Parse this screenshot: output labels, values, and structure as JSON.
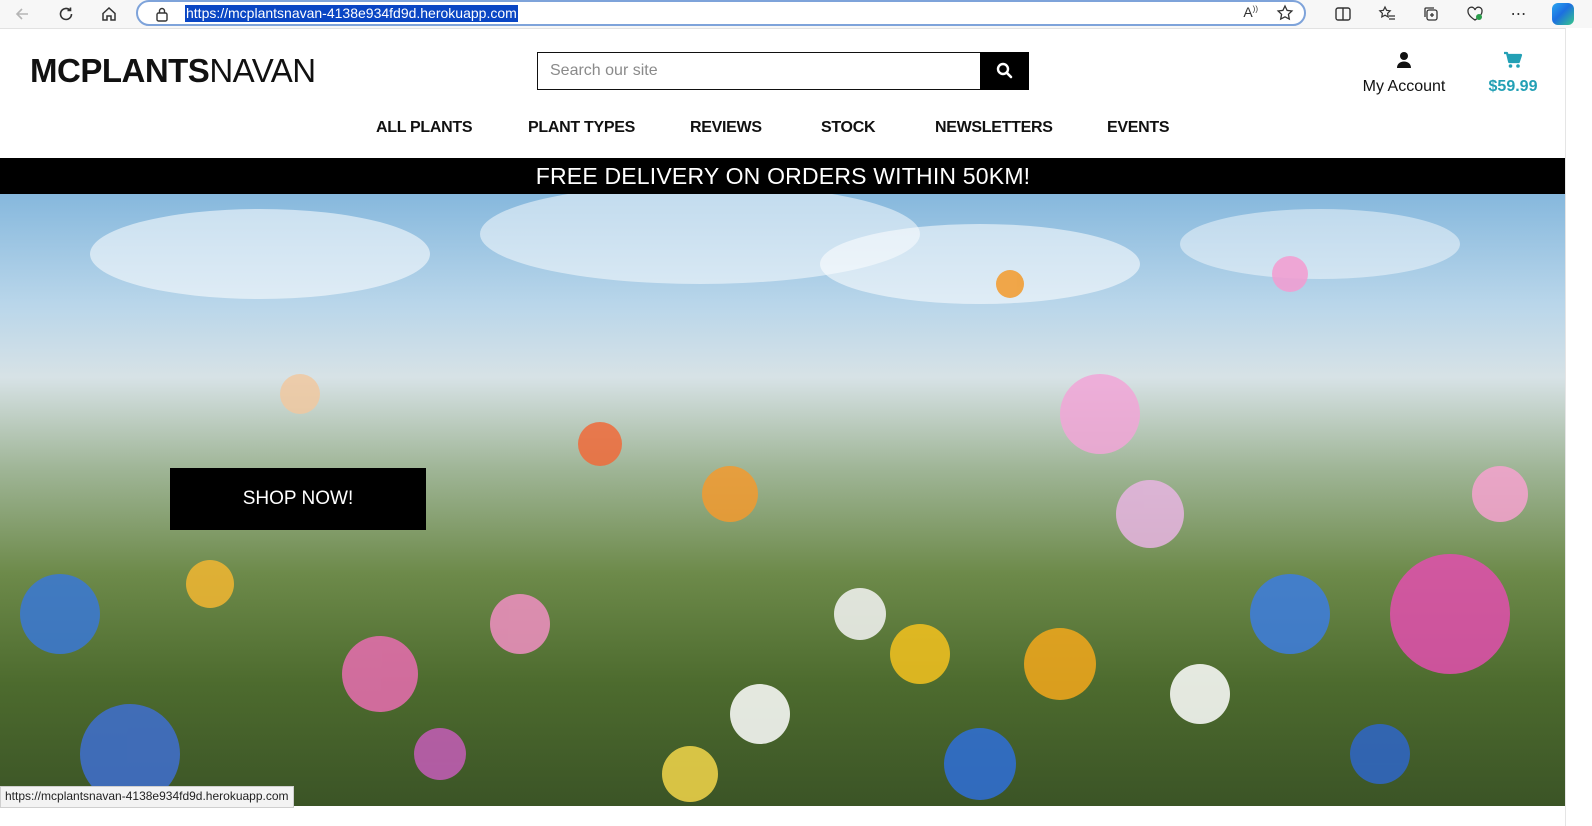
{
  "browser": {
    "url": "https://mcplantsnavan-4138e934fd9d.herokuapp.com",
    "status_url": "https://mcplantsnavan-4138e934fd9d.herokuapp.com",
    "icons": [
      "back-icon",
      "refresh-icon",
      "home-icon",
      "lock-icon",
      "read-aloud-icon",
      "favorite-star-icon",
      "split-screen-icon",
      "favorites-icon",
      "collections-icon",
      "browser-essentials-icon",
      "more-icon",
      "copilot-icon"
    ]
  },
  "site": {
    "logo_bold": "MCPLANTS",
    "logo_regular": "NAVAN",
    "search": {
      "placeholder": "Search our site"
    },
    "account_label": "My Account",
    "cart_total": "$59.99",
    "accent_color": "#23a0b5",
    "nav": [
      "ALL PLANTS",
      "PLANT TYPES",
      "REVIEWS",
      "STOCK",
      "NEWSLETTERS",
      "EVENTS"
    ],
    "banner": "FREE DELIVERY ON ORDERS WITHIN 50KM!",
    "hero": {
      "button": "SHOP NOW!"
    }
  }
}
